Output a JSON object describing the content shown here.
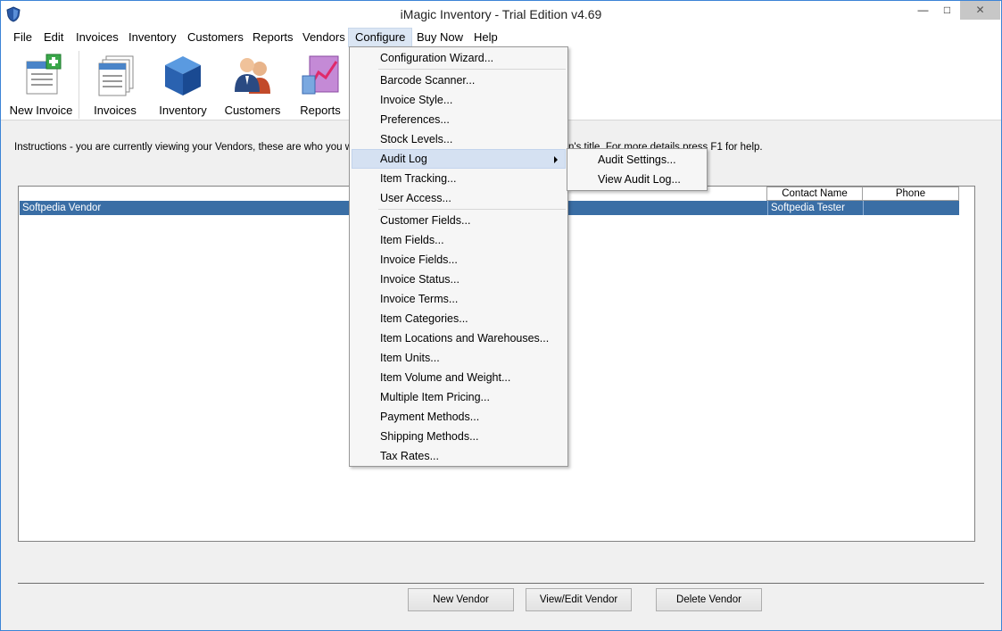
{
  "window": {
    "title": "iMagic Inventory - Trial Edition v4.69"
  },
  "titlebar_buttons": {
    "minimize": "—",
    "maximize": "□",
    "close": "✕"
  },
  "menubar": {
    "items": [
      "File",
      "Edit",
      "Invoices",
      "Inventory",
      "Customers",
      "Reports",
      "Vendors",
      "Configure",
      "Buy Now",
      "Help"
    ],
    "open_item": "Configure"
  },
  "toolbar": {
    "new_invoice": "New Invoice",
    "invoices": "Invoices",
    "inventory": "Inventory",
    "customers": "Customers",
    "reports": "Reports"
  },
  "instructions": {
    "lead": "Instructions - you are currently viewing your Vendors, these are who you would p",
    "tail": "n's title. For more details press F1 for help."
  },
  "vendor_list": {
    "columns": [
      "Contact Name",
      "Phone"
    ],
    "rows": [
      {
        "name": "Softpedia Vendor",
        "contact": "Softpedia Tester",
        "phone": ""
      }
    ]
  },
  "buttons": {
    "new_vendor": "New Vendor",
    "view_edit_vendor": "View/Edit Vendor",
    "delete_vendor": "Delete Vendor"
  },
  "configure_menu": {
    "items": [
      "Configuration Wizard...",
      "Barcode Scanner...",
      "Invoice Style...",
      "Preferences...",
      "Stock Levels...",
      "Audit Log",
      "Item Tracking...",
      "User Access...",
      "Customer Fields...",
      "Item Fields...",
      "Invoice Fields...",
      "Invoice Status...",
      "Invoice Terms...",
      "Item Categories...",
      "Item Locations and Warehouses...",
      "Item Units...",
      "Item Volume and Weight...",
      "Multiple Item Pricing...",
      "Payment Methods...",
      "Shipping Methods...",
      "Tax Rates..."
    ],
    "highlighted": "Audit Log"
  },
  "audit_log_submenu": {
    "items": [
      "Audit Settings...",
      "View Audit Log..."
    ]
  },
  "colors": {
    "selection": "#3a6ea5",
    "menu_highlight": "#d5e1f2",
    "window_border": "#3c84d6"
  }
}
